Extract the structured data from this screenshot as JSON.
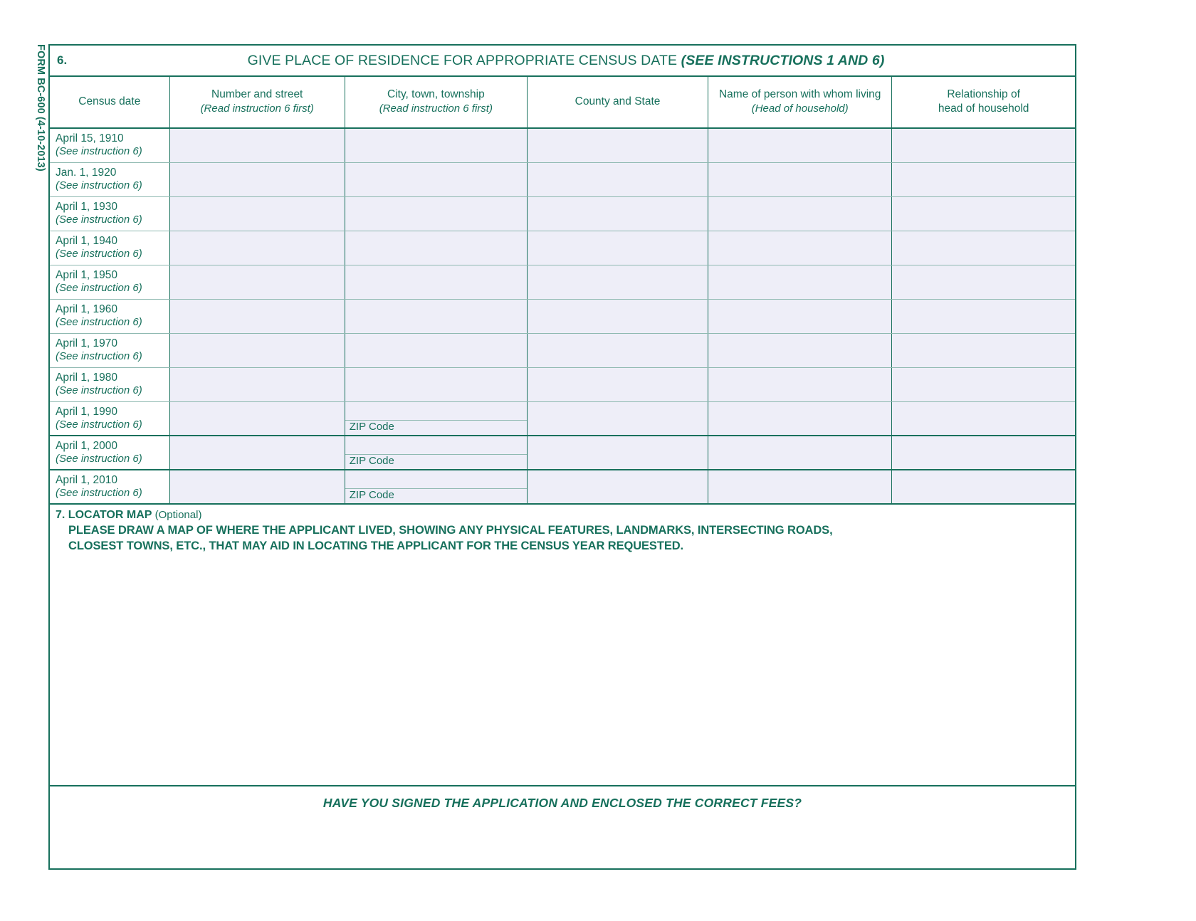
{
  "form": {
    "form_number_label": "FORM BC-600 (4-10-2013)"
  },
  "section6": {
    "number": "6.",
    "title_main": "GIVE PLACE OF RESIDENCE FOR APPROPRIATE CENSUS DATE ",
    "title_italic": "(SEE INSTRUCTIONS 1 AND 6)",
    "columns": [
      {
        "title": "Census date",
        "sub": ""
      },
      {
        "title": "Number and street",
        "sub": "(Read instruction 6 first)"
      },
      {
        "title": "City, town, township",
        "sub": "(Read instruction 6 first)"
      },
      {
        "title": "County and State",
        "sub": ""
      },
      {
        "title": "Name of person with whom living",
        "sub": "(Head of household)"
      },
      {
        "title": "Relationship of",
        "sub2": "head of household"
      }
    ],
    "column_headers_flat": [
      "Census date",
      "Number and street",
      "City, town, township",
      "County and State",
      "Name of person with whom living",
      "Relationship of head of household"
    ],
    "zip_label": "ZIP Code",
    "rows": [
      {
        "date": "April 15, 1910",
        "instruction": "(See instruction 6)",
        "street": "",
        "city": "",
        "zip": "",
        "county": "",
        "name": "",
        "relationship": "",
        "has_zip": false
      },
      {
        "date": "Jan. 1, 1920",
        "instruction": "(See instruction 6)",
        "street": "",
        "city": "",
        "zip": "",
        "county": "",
        "name": "",
        "relationship": "",
        "has_zip": false
      },
      {
        "date": "April 1, 1930",
        "instruction": "(See instruction 6)",
        "street": "",
        "city": "",
        "zip": "",
        "county": "",
        "name": "",
        "relationship": "",
        "has_zip": false
      },
      {
        "date": "April 1, 1940",
        "instruction": "(See instruction 6)",
        "street": "",
        "city": "",
        "zip": "",
        "county": "",
        "name": "",
        "relationship": "",
        "has_zip": false
      },
      {
        "date": "April 1, 1950",
        "instruction": "(See instruction 6)",
        "street": "",
        "city": "",
        "zip": "",
        "county": "",
        "name": "",
        "relationship": "",
        "has_zip": false
      },
      {
        "date": "April 1, 1960",
        "instruction": "(See instruction 6)",
        "street": "",
        "city": "",
        "zip": "",
        "county": "",
        "name": "",
        "relationship": "",
        "has_zip": false
      },
      {
        "date": "April 1, 1970",
        "instruction": "(See instruction 6)",
        "street": "",
        "city": "",
        "zip": "",
        "county": "",
        "name": "",
        "relationship": "",
        "has_zip": false
      },
      {
        "date": "April 1, 1980",
        "instruction": "(See instruction 6)",
        "street": "",
        "city": "",
        "zip": "",
        "county": "",
        "name": "",
        "relationship": "",
        "has_zip": false
      },
      {
        "date": "April 1, 1990",
        "instruction": "(See instruction 6)",
        "street": "",
        "city": "",
        "zip": "",
        "county": "",
        "name": "",
        "relationship": "",
        "has_zip": true
      },
      {
        "date": "April 1, 2000",
        "instruction": "(See instruction 6)",
        "street": "",
        "city": "",
        "zip": "",
        "county": "",
        "name": "",
        "relationship": "",
        "has_zip": true
      },
      {
        "date": "April 1, 2010",
        "instruction": "(See instruction 6)",
        "street": "",
        "city": "",
        "zip": "",
        "county": "",
        "name": "",
        "relationship": "",
        "has_zip": true
      }
    ]
  },
  "section7": {
    "number_and_title": "7. LOCATOR MAP",
    "optional": "(Optional)",
    "instruction_line1": "PLEASE DRAW A MAP OF WHERE THE APPLICANT LIVED, SHOWING ANY PHYSICAL FEATURES, LANDMARKS, INTERSECTING ROADS,",
    "instruction_line2": "CLOSEST TOWNS, ETC., THAT MAY AID IN LOCATING THE APPLICANT FOR THE CENSUS YEAR REQUESTED.",
    "drawing_area_value": ""
  },
  "footer": {
    "question": "HAVE YOU SIGNED THE APPLICATION AND ENCLOSED THE CORRECT FEES?"
  },
  "colors": {
    "ink": "#17705c",
    "field_fill": "#eeeef8",
    "rule_light": "#8fb9b1",
    "page": "#ffffff"
  }
}
